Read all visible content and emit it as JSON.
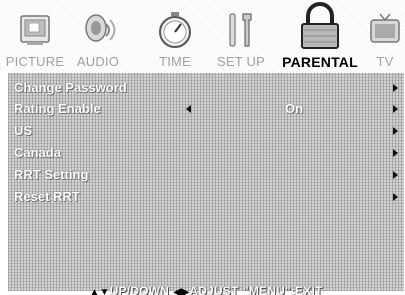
{
  "tabs": [
    {
      "label": "PICTURE",
      "icon": "picture-icon",
      "active": false
    },
    {
      "label": "AUDIO",
      "icon": "audio-icon",
      "active": false
    },
    {
      "label": "TIME",
      "icon": "stopwatch-icon",
      "active": false
    },
    {
      "label": "SET UP",
      "icon": "tools-icon",
      "active": false
    },
    {
      "label": "PARENTAL",
      "icon": "lock-icon",
      "active": true
    },
    {
      "label": "TV",
      "icon": "tv-icon",
      "active": false
    }
  ],
  "menu": {
    "items": [
      {
        "label": "Change Password"
      },
      {
        "label": "Rating Enable",
        "value": "On"
      },
      {
        "label": "US"
      },
      {
        "label": "Canada"
      },
      {
        "label": "RRT Setting"
      },
      {
        "label": "Reset RRT"
      }
    ]
  },
  "footer": {
    "updown_glyph": "▲▼",
    "updown_label": "UP/DOWN",
    "adjust_glyph": "◀▶",
    "adjust_label": "ADJUST",
    "menu_label": "\"MENU\":EXIT"
  },
  "colors": {
    "active_tab_text": "#000000",
    "inactive_tab_text": "#a0a0a0",
    "menu_text": "#ffffff",
    "panel_background": "#d2d2d2"
  }
}
